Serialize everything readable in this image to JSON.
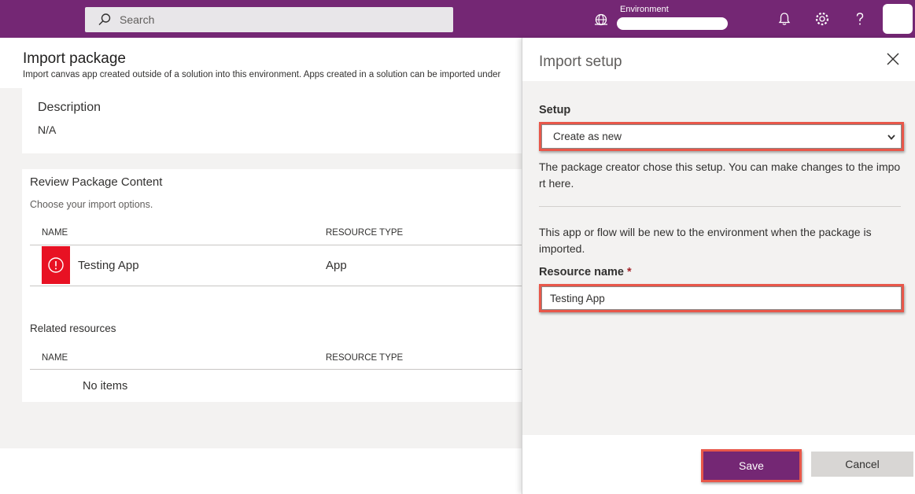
{
  "topbar": {
    "search_placeholder": "Search",
    "environment_label": "Environment",
    "icons": [
      "search-icon",
      "environment-icon",
      "bell-icon",
      "gear-icon",
      "help-icon"
    ],
    "brand_color": "#742774"
  },
  "page": {
    "title": "Import package",
    "subtitle": "Import canvas app created outside of a solution into this environment. Apps created in a solution can be imported under",
    "description": {
      "title": "Description",
      "value": "N/A"
    },
    "review": {
      "title": "Review Package Content",
      "subtitle": "Choose your import options.",
      "columns": [
        "NAME",
        "RESOURCE TYPE"
      ],
      "rows": [
        {
          "name": "Testing App",
          "type": "App",
          "status": "error"
        }
      ],
      "related_title": "Related resources",
      "related_columns": [
        "NAME",
        "RESOURCE TYPE"
      ],
      "related_empty": "No items"
    }
  },
  "panel": {
    "title": "Import setup",
    "setup_label": "Setup",
    "setup_selected": "Create as new",
    "setup_help": "The package creator chose this setup. You can make changes to the import here.",
    "new_help": "This app or flow will be new to the environment when the package is imported.",
    "resource_name_label": "Resource name",
    "required_mark": "*",
    "resource_name_value": "Testing App",
    "save_label": "Save",
    "cancel_label": "Cancel",
    "highlight_color": "#e8574a",
    "error_color": "#e81123"
  }
}
